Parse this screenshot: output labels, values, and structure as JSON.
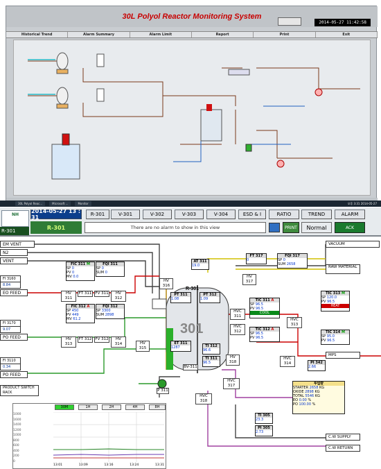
{
  "top_window": {
    "title": "30L Polyol Reactor Monitoring System",
    "datetime": "2014-05-27  11:42:58",
    "menu": [
      "Historical Trend",
      "Alarm Summary",
      "Alarm Limit",
      "Report",
      "Print",
      "Exit"
    ]
  },
  "taskbar": {
    "items": [
      "30L Polyol Reac...",
      "Microsoft ...",
      "Monitor"
    ],
    "clock": "오후 3:31 2014-05-27"
  },
  "hmi": {
    "logo": "NH",
    "date": "2014-05-27  13 : 31",
    "view": "R-301",
    "tag": "R-301",
    "nav": [
      "R-301",
      "V-301",
      "V-302",
      "V-303",
      "V-304",
      "ESD & I",
      "RATIO",
      "TREND",
      "ALARM"
    ],
    "alarm_msg": "There are no alarm to show in this view",
    "print": "PRINT",
    "status": "Normal",
    "ack": "ACK"
  },
  "left_tags": [
    "EM VENT",
    "N2",
    "VENT",
    "FI 3160",
    "8.84",
    "EO FEED",
    "FI 3170",
    "9.07",
    "PO FEED",
    "FI 3110",
    "0.34",
    "PO FEED",
    "PRODUCT SWITCH RACK"
  ],
  "right_tags": [
    "VACUUM",
    "RAW MATERIAL",
    "MPS",
    "C.W SUPPLY",
    "C.W RETURN"
  ],
  "fic311": {
    "title": "FIC 311",
    "mode": "M",
    "sp": "0",
    "pv": "0",
    "mv": "0.0",
    "unit": "KG/H"
  },
  "fqi311": {
    "title": "FQI 311",
    "sp": "0",
    "sum": "0",
    "unit": "KG"
  },
  "fic312": {
    "title": "FIC 312",
    "mode": "A",
    "sp": "450",
    "pv": "449",
    "mv": "61.2",
    "unit": "KG/H"
  },
  "fqi312": {
    "title": "FQI 312",
    "sp": "3300",
    "sum": "2898",
    "unit": "KG"
  },
  "at311": {
    "title": "AT 311",
    "value": "19.0",
    "unit": "%"
  },
  "ft317": {
    "title": "FT 317",
    "value": "0"
  },
  "fqi317": {
    "title": "FQI 317",
    "sp": "0",
    "sum": "2658",
    "unit": "KG"
  },
  "reactor": {
    "name": "R-301",
    "label": "301"
  },
  "pt311": {
    "title": "PT 311",
    "value": "1.08"
  },
  "pt312": {
    "title": "PT 312",
    "value": "1.09"
  },
  "et311": {
    "title": "ET 311",
    "value": "1287",
    "unit": "mm/min"
  },
  "ti312": {
    "title": "TI 312",
    "value": "96.6"
  },
  "ti311": {
    "title": "TI 311",
    "value": "96.5"
  },
  "tic311": {
    "title": "TIC 311",
    "mode": "A",
    "sp": "96.5",
    "pv": "96.5",
    "state": "COOL"
  },
  "tic312": {
    "title": "TIC 312",
    "mode": "A",
    "sp": "96.5",
    "pv": "96.5"
  },
  "tic313": {
    "title": "TIC 313",
    "mode": "M",
    "sp": "120.0",
    "pv": "96.5",
    "state": "HEAT"
  },
  "tic314": {
    "title": "TIC 314",
    "mode": "M",
    "sp": "95.0",
    "pv": "96.5"
  },
  "pi342": {
    "title": "PI 342",
    "value": "2.66"
  },
  "ti305": {
    "title": "TI 305",
    "value": "23.3"
  },
  "pi305": {
    "title": "PI 305",
    "value": "2.73"
  },
  "summary": {
    "title": "투입량",
    "rows": [
      [
        "STARTER",
        "2658",
        "KG"
      ],
      [
        "OXIDE",
        "2898",
        "KG"
      ],
      [
        "TOTAL",
        "5546",
        "KG"
      ],
      [
        "EO",
        "0.00",
        "%"
      ],
      [
        "PO",
        "100.00",
        "%"
      ]
    ]
  },
  "valves": [
    "HV 311",
    "FT 311",
    "FV 311",
    "HV 312",
    "HV 313",
    "FT 312",
    "FV 312",
    "HV 314",
    "HV 315",
    "HV 316",
    "HVC 311",
    "HVC 312",
    "HVC 313",
    "HVC 314",
    "HVC 317",
    "HVC 318",
    "HV 317",
    "HV 318",
    "BV-311",
    "P 311"
  ],
  "trend": {
    "tabs": [
      "30M",
      "1H",
      "2H",
      "4H",
      "8H"
    ],
    "times": [
      "13:01",
      "13:09",
      "13:16",
      "13:24",
      "13:31"
    ],
    "scale_rows": [
      "1000",
      "1600",
      "1400",
      "1200",
      "1000",
      "800",
      "600",
      "400",
      "200",
      "0"
    ]
  }
}
